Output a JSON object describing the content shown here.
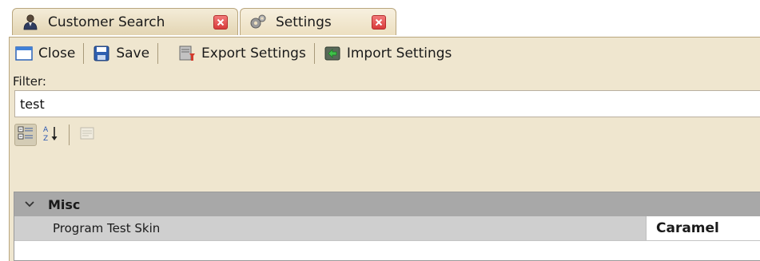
{
  "tabs": [
    {
      "label": "Customer Search",
      "icon": "person-search-icon"
    },
    {
      "label": "Settings",
      "icon": "gears-icon"
    }
  ],
  "toolbar": {
    "close_label": "Close",
    "save_label": "Save",
    "export_label": "Export Settings",
    "import_label": "Import Settings"
  },
  "filter": {
    "label": "Filter:",
    "value": "test"
  },
  "property_grid": {
    "toolbar": [
      "categorized-view-icon",
      "sort-alphabetical-icon",
      "property-pages-icon"
    ],
    "category": "Misc",
    "properties": [
      {
        "name": "Program Test Skin",
        "value": "Caramel"
      }
    ]
  },
  "colors": {
    "tab_bg": "#ecdfc0",
    "toolbar_bg": "#efe6cf",
    "category_bg": "#a8a8a8",
    "row_bg": "#cfcfcf",
    "close_red": "#d83b3b"
  }
}
